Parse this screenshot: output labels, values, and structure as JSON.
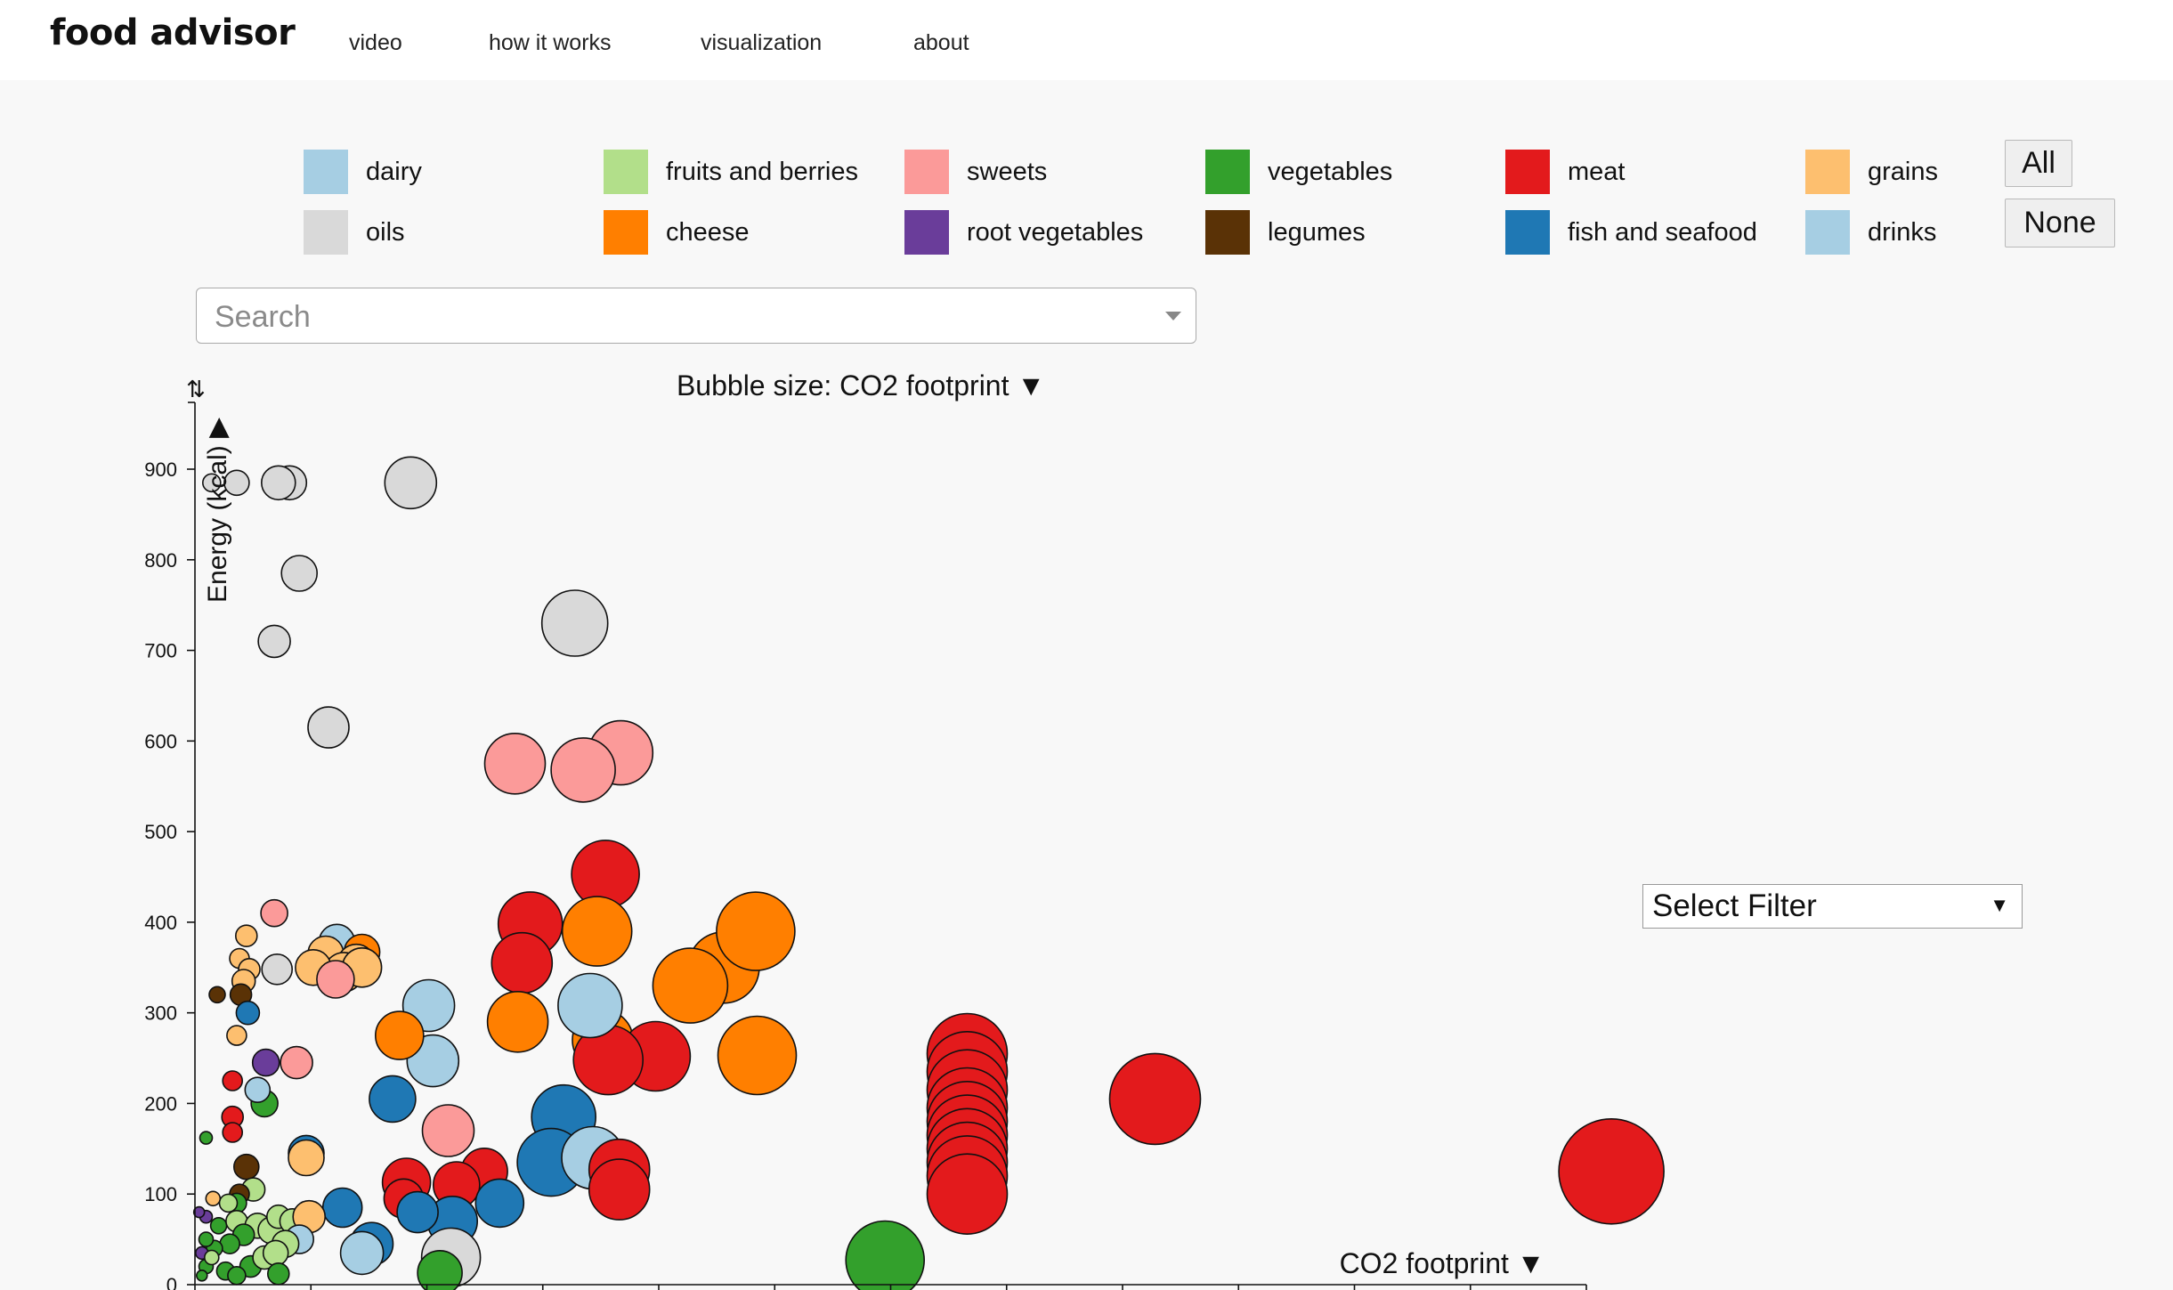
{
  "app": {
    "brand": "food advisor"
  },
  "nav": [
    "video",
    "how it works",
    "visualization",
    "about"
  ],
  "legend": [
    {
      "label": "dairy",
      "color": "#a6cee3"
    },
    {
      "label": "fruits and berries",
      "color": "#b2df8a"
    },
    {
      "label": "sweets",
      "color": "#fb9a99"
    },
    {
      "label": "vegetables",
      "color": "#33a02c"
    },
    {
      "label": "meat",
      "color": "#e31a1c"
    },
    {
      "label": "grains",
      "color": "#fdbf6f"
    },
    {
      "label": "oils",
      "color": "#d9d9d9"
    },
    {
      "label": "cheese",
      "color": "#ff7f00"
    },
    {
      "label": "root vegetables",
      "color": "#6a3d9a"
    },
    {
      "label": "legumes",
      "color": "#5a3206"
    },
    {
      "label": "fish and seafood",
      "color": "#1f78b4"
    },
    {
      "label": "drinks",
      "color": "#a6cee3"
    }
  ],
  "buttons": {
    "all": "All",
    "none": "None"
  },
  "search": {
    "placeholder": "Search"
  },
  "bubble_size_label": "Bubble size: CO2 footprint ▼",
  "filter": {
    "label": "Select Filter",
    "arrow": "▼"
  },
  "chart_data": {
    "type": "scatter",
    "xlabel": "CO2 footprint ▼",
    "ylabel": "Energy (kcal) ▶",
    "sort_icon": "⇅",
    "ylim": [
      0,
      970
    ],
    "xlim": [
      0,
      1000
    ],
    "yticks": [
      0,
      100,
      200,
      300,
      400,
      500,
      600,
      700,
      800,
      900
    ],
    "xtick_count": 13,
    "grid": false,
    "points": [
      {
        "c": "oils",
        "x": 12,
        "y": 885,
        "r": 10
      },
      {
        "c": "oils",
        "x": 30,
        "y": 885,
        "r": 14
      },
      {
        "c": "oils",
        "x": 68,
        "y": 885,
        "r": 19
      },
      {
        "c": "oils",
        "x": 60,
        "y": 885,
        "r": 19
      },
      {
        "c": "oils",
        "x": 155,
        "y": 885,
        "r": 29
      },
      {
        "c": "oils",
        "x": 75,
        "y": 785,
        "r": 20
      },
      {
        "c": "oils",
        "x": 57,
        "y": 710,
        "r": 18
      },
      {
        "c": "oils",
        "x": 96,
        "y": 615,
        "r": 23
      },
      {
        "c": "oils",
        "x": 273,
        "y": 730,
        "r": 37
      },
      {
        "c": "sweets",
        "x": 230,
        "y": 575,
        "r": 34
      },
      {
        "c": "sweets",
        "x": 306,
        "y": 587,
        "r": 36
      },
      {
        "c": "sweets",
        "x": 279,
        "y": 568,
        "r": 36
      },
      {
        "c": "meat",
        "x": 295,
        "y": 453,
        "r": 38
      },
      {
        "c": "meat",
        "x": 241,
        "y": 398,
        "r": 36
      },
      {
        "c": "meat",
        "x": 235,
        "y": 355,
        "r": 34
      },
      {
        "c": "cheese",
        "x": 289,
        "y": 390,
        "r": 39
      },
      {
        "c": "cheese",
        "x": 380,
        "y": 350,
        "r": 40
      },
      {
        "c": "cheese",
        "x": 403,
        "y": 390,
        "r": 44
      },
      {
        "c": "cheese",
        "x": 356,
        "y": 330,
        "r": 42
      },
      {
        "c": "cheese",
        "x": 232,
        "y": 290,
        "r": 34
      },
      {
        "c": "cheese",
        "x": 293,
        "y": 270,
        "r": 34
      },
      {
        "c": "cheese",
        "x": 404,
        "y": 253,
        "r": 44
      },
      {
        "c": "meat",
        "x": 331,
        "y": 252,
        "r": 39
      },
      {
        "c": "meat",
        "x": 297,
        "y": 248,
        "r": 39
      },
      {
        "c": "drinks",
        "x": 284,
        "y": 308,
        "r": 36
      },
      {
        "c": "drinks",
        "x": 168,
        "y": 308,
        "r": 29
      },
      {
        "c": "drinks",
        "x": 171,
        "y": 247,
        "r": 29
      },
      {
        "c": "cheese",
        "x": 147,
        "y": 275,
        "r": 27
      },
      {
        "c": "fish and seafood",
        "x": 142,
        "y": 205,
        "r": 26
      },
      {
        "c": "sweets",
        "x": 182,
        "y": 170,
        "r": 29
      },
      {
        "c": "fish and seafood",
        "x": 265,
        "y": 185,
        "r": 36
      },
      {
        "c": "fish and seafood",
        "x": 256,
        "y": 135,
        "r": 38
      },
      {
        "c": "drinks",
        "x": 286,
        "y": 140,
        "r": 35
      },
      {
        "c": "meat",
        "x": 305,
        "y": 127,
        "r": 34
      },
      {
        "c": "meat",
        "x": 305,
        "y": 105,
        "r": 34
      },
      {
        "c": "meat",
        "x": 208,
        "y": 125,
        "r": 26
      },
      {
        "c": "meat",
        "x": 188,
        "y": 110,
        "r": 26
      },
      {
        "c": "meat",
        "x": 152,
        "y": 113,
        "r": 27
      },
      {
        "c": "meat",
        "x": 150,
        "y": 95,
        "r": 22
      },
      {
        "c": "fish and seafood",
        "x": 219,
        "y": 90,
        "r": 27
      },
      {
        "c": "fish and seafood",
        "x": 185,
        "y": 70,
        "r": 28
      },
      {
        "c": "fish and seafood",
        "x": 160,
        "y": 80,
        "r": 23
      },
      {
        "c": "fish and seafood",
        "x": 127,
        "y": 45,
        "r": 24
      },
      {
        "c": "fish and seafood",
        "x": 106,
        "y": 85,
        "r": 22
      },
      {
        "c": "drinks",
        "x": 120,
        "y": 35,
        "r": 24
      },
      {
        "c": "oils",
        "x": 184,
        "y": 30,
        "r": 33
      },
      {
        "c": "vegetables",
        "x": 176,
        "y": 13,
        "r": 25
      },
      {
        "c": "sweets",
        "x": 57,
        "y": 410,
        "r": 15
      },
      {
        "c": "grains",
        "x": 37,
        "y": 385,
        "r": 12
      },
      {
        "c": "grains",
        "x": 32,
        "y": 360,
        "r": 11
      },
      {
        "c": "oils",
        "x": 59,
        "y": 348,
        "r": 17
      },
      {
        "c": "grains",
        "x": 39,
        "y": 348,
        "r": 12
      },
      {
        "c": "drinks",
        "x": 102,
        "y": 378,
        "r": 20
      },
      {
        "c": "grains",
        "x": 94,
        "y": 365,
        "r": 20
      },
      {
        "c": "cheese",
        "x": 120,
        "y": 367,
        "r": 20
      },
      {
        "c": "grains",
        "x": 116,
        "y": 355,
        "r": 21
      },
      {
        "c": "grains",
        "x": 107,
        "y": 345,
        "r": 22
      },
      {
        "c": "grains",
        "x": 120,
        "y": 350,
        "r": 22
      },
      {
        "c": "grains",
        "x": 85,
        "y": 350,
        "r": 20
      },
      {
        "c": "sweets",
        "x": 101,
        "y": 337,
        "r": 21
      },
      {
        "c": "grains",
        "x": 35,
        "y": 335,
        "r": 13
      },
      {
        "c": "legumes",
        "x": 33,
        "y": 320,
        "r": 12
      },
      {
        "c": "legumes",
        "x": 16,
        "y": 320,
        "r": 9
      },
      {
        "c": "fish and seafood",
        "x": 38,
        "y": 300,
        "r": 13
      },
      {
        "c": "grains",
        "x": 30,
        "y": 275,
        "r": 11
      },
      {
        "c": "sweets",
        "x": 73,
        "y": 245,
        "r": 18
      },
      {
        "c": "root vegetables",
        "x": 51,
        "y": 245,
        "r": 15
      },
      {
        "c": "vegetables",
        "x": 50,
        "y": 200,
        "r": 15
      },
      {
        "c": "drinks",
        "x": 45,
        "y": 215,
        "r": 14
      },
      {
        "c": "meat",
        "x": 27,
        "y": 225,
        "r": 11
      },
      {
        "c": "meat",
        "x": 27,
        "y": 185,
        "r": 12
      },
      {
        "c": "meat",
        "x": 27,
        "y": 168,
        "r": 11
      },
      {
        "c": "vegetables",
        "x": 8,
        "y": 162,
        "r": 7
      },
      {
        "c": "fish and seafood",
        "x": 80,
        "y": 145,
        "r": 20
      },
      {
        "c": "grains",
        "x": 80,
        "y": 140,
        "r": 20
      },
      {
        "c": "legumes",
        "x": 37,
        "y": 130,
        "r": 14
      },
      {
        "c": "fruits and berries",
        "x": 42,
        "y": 105,
        "r": 13
      },
      {
        "c": "legumes",
        "x": 32,
        "y": 100,
        "r": 11
      },
      {
        "c": "vegetables",
        "x": 30,
        "y": 90,
        "r": 11
      },
      {
        "c": "fruits and berries",
        "x": 24,
        "y": 90,
        "r": 10
      },
      {
        "c": "grains",
        "x": 13,
        "y": 95,
        "r": 8
      },
      {
        "c": "root vegetables",
        "x": 8,
        "y": 75,
        "r": 7
      },
      {
        "c": "root vegetables",
        "x": 3,
        "y": 80,
        "r": 6
      },
      {
        "c": "vegetables",
        "x": 17,
        "y": 65,
        "r": 9
      },
      {
        "c": "fruits and berries",
        "x": 30,
        "y": 70,
        "r": 12
      },
      {
        "c": "fruits and berries",
        "x": 45,
        "y": 65,
        "r": 14
      },
      {
        "c": "fruits and berries",
        "x": 55,
        "y": 60,
        "r": 15
      },
      {
        "c": "fruits and berries",
        "x": 60,
        "y": 75,
        "r": 13
      },
      {
        "c": "fruits and berries",
        "x": 70,
        "y": 70,
        "r": 14
      },
      {
        "c": "grains",
        "x": 82,
        "y": 75,
        "r": 18
      },
      {
        "c": "drinks",
        "x": 75,
        "y": 50,
        "r": 16
      },
      {
        "c": "fruits and berries",
        "x": 65,
        "y": 45,
        "r": 15
      },
      {
        "c": "vegetables",
        "x": 35,
        "y": 55,
        "r": 12
      },
      {
        "c": "vegetables",
        "x": 25,
        "y": 45,
        "r": 11
      },
      {
        "c": "vegetables",
        "x": 14,
        "y": 40,
        "r": 9
      },
      {
        "c": "vegetables",
        "x": 8,
        "y": 50,
        "r": 8
      },
      {
        "c": "root vegetables",
        "x": 5,
        "y": 35,
        "r": 7
      },
      {
        "c": "vegetables",
        "x": 8,
        "y": 20,
        "r": 8
      },
      {
        "c": "vegetables",
        "x": 22,
        "y": 15,
        "r": 10
      },
      {
        "c": "vegetables",
        "x": 40,
        "y": 20,
        "r": 12
      },
      {
        "c": "fruits and berries",
        "x": 50,
        "y": 30,
        "r": 13
      },
      {
        "c": "fruits and berries",
        "x": 58,
        "y": 35,
        "r": 14
      },
      {
        "c": "vegetables",
        "x": 30,
        "y": 10,
        "r": 10
      },
      {
        "c": "vegetables",
        "x": 60,
        "y": 12,
        "r": 12
      },
      {
        "c": "fruits and berries",
        "x": 12,
        "y": 30,
        "r": 8
      },
      {
        "c": "vegetables",
        "x": 5,
        "y": 10,
        "r": 6
      },
      {
        "c": "meat",
        "x": 555,
        "y": 255,
        "r": 45
      },
      {
        "c": "meat",
        "x": 555,
        "y": 235,
        "r": 45
      },
      {
        "c": "meat",
        "x": 555,
        "y": 215,
        "r": 45
      },
      {
        "c": "meat",
        "x": 555,
        "y": 195,
        "r": 45
      },
      {
        "c": "meat",
        "x": 555,
        "y": 180,
        "r": 45
      },
      {
        "c": "meat",
        "x": 555,
        "y": 165,
        "r": 45
      },
      {
        "c": "meat",
        "x": 555,
        "y": 150,
        "r": 45
      },
      {
        "c": "meat",
        "x": 555,
        "y": 135,
        "r": 45
      },
      {
        "c": "meat",
        "x": 555,
        "y": 120,
        "r": 45
      },
      {
        "c": "meat",
        "x": 555,
        "y": 100,
        "r": 45
      },
      {
        "c": "meat",
        "x": 690,
        "y": 205,
        "r": 51
      },
      {
        "c": "meat",
        "x": 1018,
        "y": 125,
        "r": 59
      },
      {
        "c": "vegetables",
        "x": 496,
        "y": 27,
        "r": 44
      }
    ]
  }
}
